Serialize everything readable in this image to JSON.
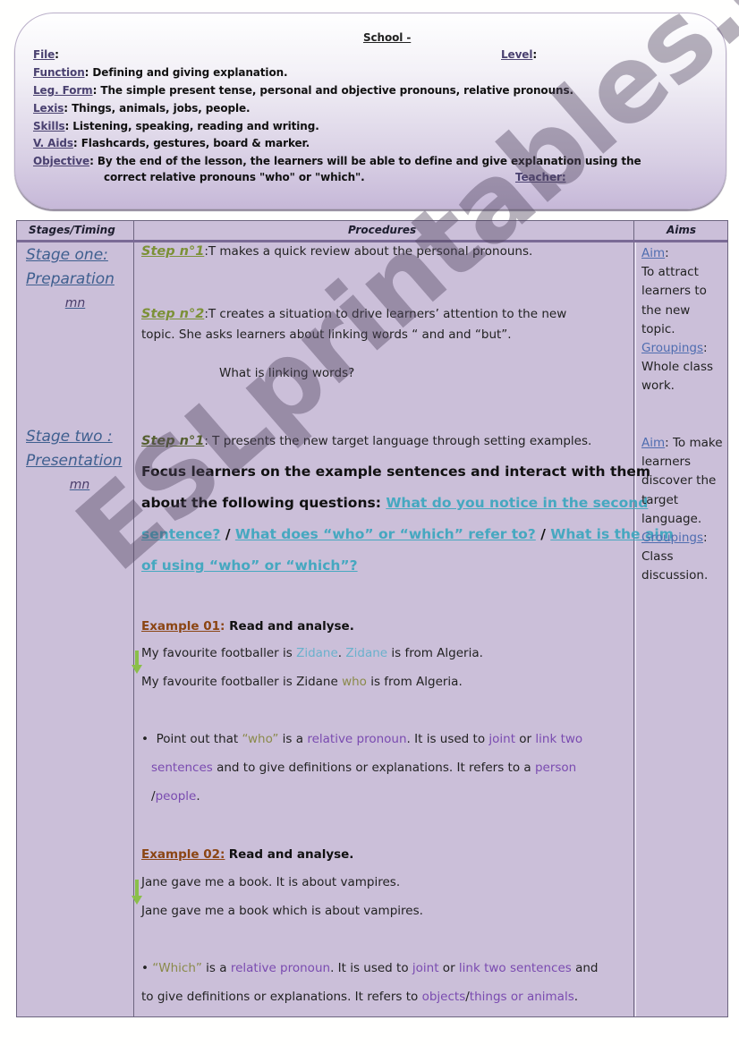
{
  "header": {
    "school": "School -",
    "file_label": "File",
    "file_value": "",
    "level_label": "Level",
    "level_value": "",
    "function_label": "Function",
    "function_value": "Defining and giving explanation.",
    "leg_form_label": "Leg. Form",
    "leg_form_value": "The simple present tense, personal and objective pronouns, relative pronouns.",
    "lexis_label": "Lexis",
    "lexis_value": "Things, animals, jobs, people.",
    "skills_label": "Skills",
    "skills_value": "Listening, speaking, reading and writing.",
    "v_aids_label": "V. Aids",
    "v_aids_value": "Flashcards, gestures, board & marker.",
    "objective_label": "Objective",
    "objective_line1": "By the end of the lesson, the learners will be able to define and give explanation using the",
    "objective_line2": "correct relative pronouns \"who\" or \"which\".",
    "teacher_label": "Teacher:"
  },
  "table": {
    "columns": [
      "Stages/Timing",
      "Procedures",
      "Aims"
    ],
    "stages": [
      {
        "title_line1": "Stage one:",
        "title_line2": "Preparation",
        "timing": "mn"
      },
      {
        "title_line1": "Stage two :",
        "title_line2": "Presentation",
        "timing": "mn"
      }
    ],
    "procedures": {
      "s1_step1_label": "Step n°1",
      "s1_step1_text": ":T makes a quick review about the personal pronouns.",
      "s1_step2_label": "Step n°2",
      "s1_step2_text1": ":T creates a situation to drive learners’ attention to the new",
      "s1_step2_text2": "topic. She asks learners about linking words “ and and “but”.",
      "s1_question": "What is linking words?",
      "s2_step1_label": "Step n°1",
      "s2_step1_text": ": T presents the new target language through setting examples.",
      "focus_line1": "Focus learners on the example sentences and interact with them",
      "focus_line2": "about the following questions: ",
      "q1_part1": "What do you notice in the second",
      "q1_part2": "sentence?",
      "q2": "What does “who” or “which” refer to?",
      "q3_part1": "What is the aim",
      "q3_part2": "of using “who” or “which”?",
      "separator": " / ",
      "ex1_label": "Example 01",
      "ex1_instruction": "Read and analyse.",
      "ex1_s1_a": "My favourite footballer is ",
      "ex1_s1_zidane1": "Zidane",
      "ex1_s1_dot": ". ",
      "ex1_s1_zidane2": "Zidane",
      "ex1_s1_b": " is from Algeria.",
      "ex1_s2_a": "My favourite footballer is Zidane ",
      "ex1_s2_who": "who",
      "ex1_s2_b": " is from Algeria.",
      "ex1_note_bullet": "•",
      "ex1_note_a": "Point out that ",
      "ex1_note_who": "“who”",
      "ex1_note_b": " is a ",
      "ex1_note_relpron": "relative pronoun",
      "ex1_note_c": ". It is used to ",
      "ex1_note_joint": "joint",
      "ex1_note_or": " or ",
      "ex1_note_link": "link two",
      "ex1_note_sentences": "sentences",
      "ex1_note_d": " and to give definitions or explanations. It refers to a ",
      "ex1_note_person": "person",
      "ex1_note_slash": "/",
      "ex1_note_people": "people",
      "ex1_note_end": ".",
      "ex2_label": "Example 02:",
      "ex2_instruction": "Read and analyse.",
      "ex2_s1": "Jane gave me a book. It is about vampires.",
      "ex2_s2": "Jane gave me a book which is about vampires.",
      "ex2_note_bullet": "•",
      "ex2_note_which": "“Which”",
      "ex2_note_a": " is a ",
      "ex2_note_relpron": "relative pronoun",
      "ex2_note_b": ". It is used to ",
      "ex2_note_joint": "joint",
      "ex2_note_or": " or ",
      "ex2_note_link": "link two sentences",
      "ex2_note_c": " and",
      "ex2_note_d": "to give definitions or explanations. It refers to ",
      "ex2_note_objects": "objects",
      "ex2_note_slash": "/",
      "ex2_note_things": "things or animals",
      "ex2_note_end": "."
    },
    "aims": [
      {
        "aim_label": "Aim",
        "aim_text": "To attract learners to the new topic.",
        "grouping_label": "Groupings",
        "grouping_text": "Whole class work."
      },
      {
        "aim_label": "Aim",
        "aim_text": "To make learners discover the target language.",
        "grouping_label": "Groupings",
        "grouping_text": "Class discussion."
      }
    ]
  },
  "watermark": "ESLprintables.com",
  "colors": {
    "table_bg": "#cbbfd9",
    "step_label": "#7c9137",
    "question_link": "#46a8c0",
    "example_label": "#8b4513",
    "keyword_purple": "#7a4bb0",
    "arrow_green": "#8bbf4a"
  }
}
